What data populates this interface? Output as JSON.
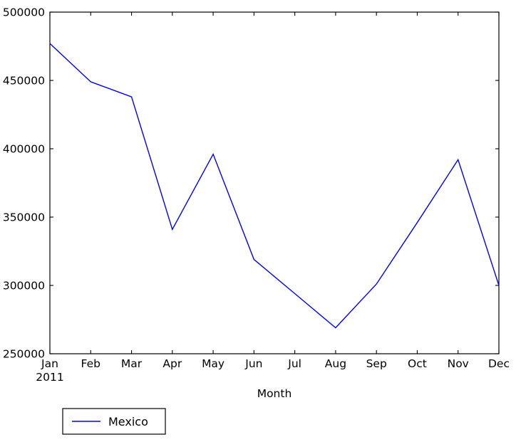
{
  "chart_data": {
    "type": "line",
    "title": "",
    "xlabel": "Month",
    "ylabel": "",
    "categories": [
      "Jan",
      "Feb",
      "Mar",
      "Apr",
      "May",
      "Jun",
      "Jul",
      "Aug",
      "Sep",
      "Oct",
      "Nov",
      "Dec"
    ],
    "x_sublabel": "2011",
    "series": [
      {
        "name": "Mexico",
        "color": "#0000ff",
        "values": [
          477000,
          449000,
          438000,
          341000,
          396000,
          319000,
          294000,
          269000,
          301000,
          346000,
          392000,
          300000
        ]
      }
    ],
    "xlim": [
      0,
      11
    ],
    "ylim": [
      250000,
      500000
    ],
    "ytick_labels": [
      "250000",
      "300000",
      "350000",
      "400000",
      "450000",
      "500000"
    ],
    "ytick_values": [
      250000,
      300000,
      350000,
      400000,
      450000,
      500000
    ],
    "grid": false,
    "legend_position": "below-left",
    "legend_entries": [
      "Mexico"
    ]
  },
  "figure": {
    "background_color": "#ffffff",
    "axes_color": "#000000"
  }
}
